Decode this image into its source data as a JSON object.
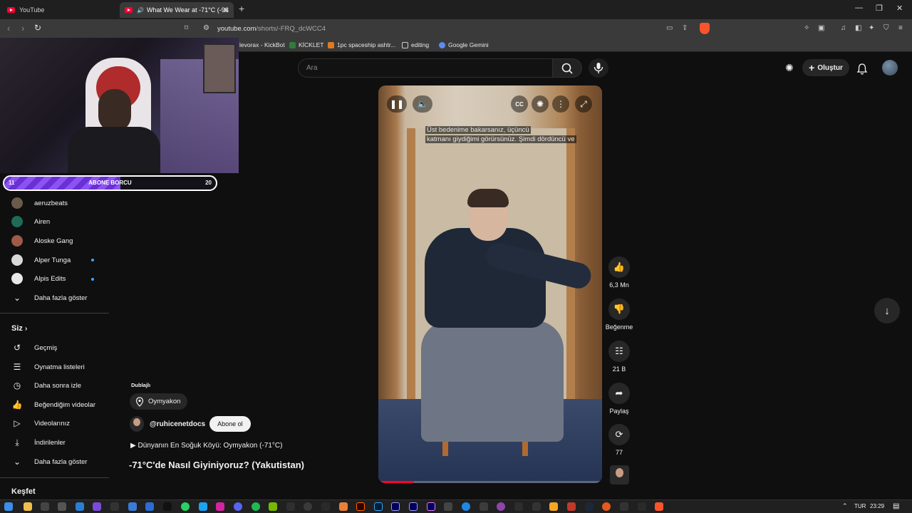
{
  "browser": {
    "tabs": [
      {
        "title": "YouTube"
      },
      {
        "title": "What We Wear at -71°C (-96"
      }
    ],
    "url_host": "youtube.com",
    "url_path": "/shorts/-FRQ_dcWCC4",
    "bookmarks": [
      "levorax - KickBot",
      "KİCKLET",
      "1pc spaceship ashtr...",
      "editing",
      "Google Gemini"
    ]
  },
  "youtube": {
    "search_placeholder": "Ara",
    "create_label": "Oluştur"
  },
  "stream_overlay": {
    "goal_label": "ABONE BORCU",
    "goal_current": "11",
    "goal_target": "20",
    "goal_progress": 0.55
  },
  "sidebar": {
    "subscriptions": [
      {
        "name": "aeruzbeats",
        "new": false,
        "color": "#6b5a4a"
      },
      {
        "name": "Airen",
        "new": false,
        "color": "#1f6b58"
      },
      {
        "name": "Aloske Gang",
        "new": false,
        "color": "#a05a48"
      },
      {
        "name": "Alper Tunga",
        "new": true,
        "color": "#d8d8d8"
      },
      {
        "name": "Alpis Edits",
        "new": true,
        "color": "#e8e8e8"
      }
    ],
    "show_more_1": "Daha fazla göster",
    "you_header": "Siz",
    "you_items": [
      {
        "label": "Geçmiş",
        "icon": "history-icon"
      },
      {
        "label": "Oynatma listeleri",
        "icon": "playlists-icon"
      },
      {
        "label": "Daha sonra izle",
        "icon": "watch-later-icon"
      },
      {
        "label": "Beğendiğim videolar",
        "icon": "liked-videos-icon"
      },
      {
        "label": "Videolarınız",
        "icon": "your-videos-icon"
      },
      {
        "label": "İndirilenler",
        "icon": "downloads-icon"
      }
    ],
    "show_more_2": "Daha fazla göster",
    "explore_header": "Keşfet"
  },
  "short": {
    "dubbed_label": "Dublajlı",
    "location": "Oymyakon",
    "channel": "@ruhicenetdocs",
    "subscribe_label": "Abone ol",
    "description": "▶ Dünyanın En Soğuk Köyü: Oymyakon (-71°C)",
    "title": "-71°C'de Nasıl Giyiniyoruz? (Yakutistan)",
    "caption_line1": "Üst bedenime bakarsanız, üçüncü",
    "caption_line2": "katmanı giydiğimi görürsünüz.  Şimdi dördüncü ve",
    "progress": 0.16
  },
  "actions": {
    "likes": "6,3 Mn",
    "dislike_label": "Beğenme",
    "comments": "21 B",
    "share_label": "Paylaş",
    "remix": "77"
  },
  "taskbar": {
    "lang": "TUR",
    "time": "23:29"
  }
}
